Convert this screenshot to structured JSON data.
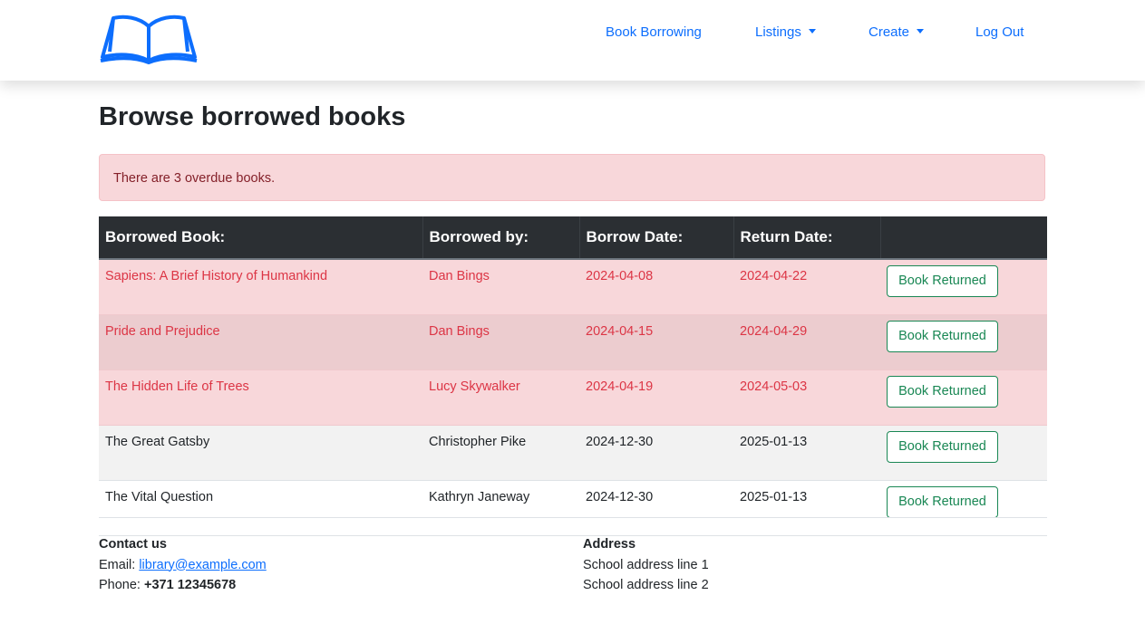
{
  "nav": {
    "logo_icon": "open-book-icon",
    "items": [
      {
        "label": "Book Borrowing"
      },
      {
        "label": "Listings"
      },
      {
        "label": "Create"
      },
      {
        "label": "Log Out"
      }
    ]
  },
  "page": {
    "title": "Browse borrowed books",
    "alert": "There are 3 overdue books."
  },
  "table": {
    "headers": [
      "Borrowed Book:",
      "Borrowed by:",
      "Borrow Date:",
      "Return Date:",
      ""
    ],
    "rows": [
      {
        "book": "Sapiens: A Brief History of Humankind",
        "by": "Dan Bings",
        "borrow": "2024-04-08",
        "return": "2024-04-22",
        "action": "Book Returned",
        "overdue": true
      },
      {
        "book": "Pride and Prejudice",
        "by": "Dan Bings",
        "borrow": "2024-04-15",
        "return": "2024-04-29",
        "action": "Book Returned",
        "overdue": true
      },
      {
        "book": "The Hidden Life of Trees",
        "by": "Lucy Skywalker",
        "borrow": "2024-04-19",
        "return": "2024-05-03",
        "action": "Book Returned",
        "overdue": true
      },
      {
        "book": "The Great Gatsby",
        "by": "Christopher Pike",
        "borrow": "2024-12-30",
        "return": "2025-01-13",
        "action": "Book Returned",
        "overdue": false
      },
      {
        "book": "The Vital Question",
        "by": "Kathryn Janeway",
        "borrow": "2024-12-30",
        "return": "2025-01-13",
        "action": "Book Returned",
        "overdue": false
      }
    ]
  },
  "footer": {
    "contact_heading": "Contact us",
    "email_label": "Email: ",
    "email": "library@example.com",
    "phone_label": "Phone: ",
    "phone": "+371 12345678",
    "address_heading": "Address",
    "address_line1": "School address line 1",
    "address_line2": "School address line 2"
  },
  "colors": {
    "link": "#0d6efd",
    "overdue_bg": "#f8d7da",
    "overdue_text": "#dc3545",
    "button": "#198754",
    "header_bg": "#2b2f33"
  }
}
